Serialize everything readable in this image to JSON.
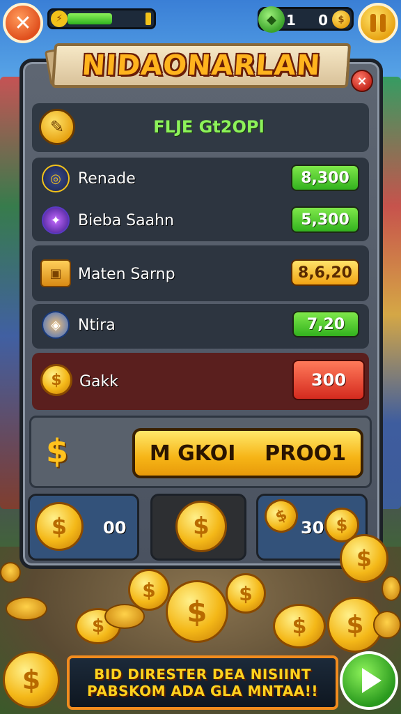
{
  "hud": {
    "close_glyph": "✕",
    "energy_fraction": 0.58,
    "gem_count": "1",
    "coin_count": "0",
    "coin_glyph": "$",
    "gem_glyph": "◆",
    "energy_glyph": "⚡"
  },
  "panel": {
    "title": "NIDAONARLAN",
    "close_glyph": "×",
    "header_text": "FLJE Gt2OPl",
    "header_icon_glyph": "✎"
  },
  "items": [
    {
      "label": "Renade",
      "price": "8,300",
      "icon": "◎"
    },
    {
      "label": "Bieba Saahn",
      "price": "5,300",
      "icon": "✦"
    },
    {
      "label": "Maten Sarnp",
      "price": "8,6,20",
      "icon": "▣"
    },
    {
      "label": "Ntira",
      "price": "7,20",
      "icon": "◈"
    },
    {
      "label": "Gakk",
      "price": "300",
      "icon": "$"
    }
  ],
  "buy": {
    "dollar": "$",
    "left_text": "M GKOI",
    "right_text": "PROO1"
  },
  "slots": {
    "slot1_value": "00",
    "slot3_value": "30"
  },
  "coin_glyph": "$",
  "promo": {
    "line1": "BID DIRESTER DEA NISIINT",
    "line2": "PABSKOM ADA GLA MNTAA!!"
  },
  "colors": {
    "price_green": "#32b21e",
    "price_yellow": "#f2a414",
    "price_red": "#d42a1e",
    "accent_gold": "#ffc21e"
  }
}
